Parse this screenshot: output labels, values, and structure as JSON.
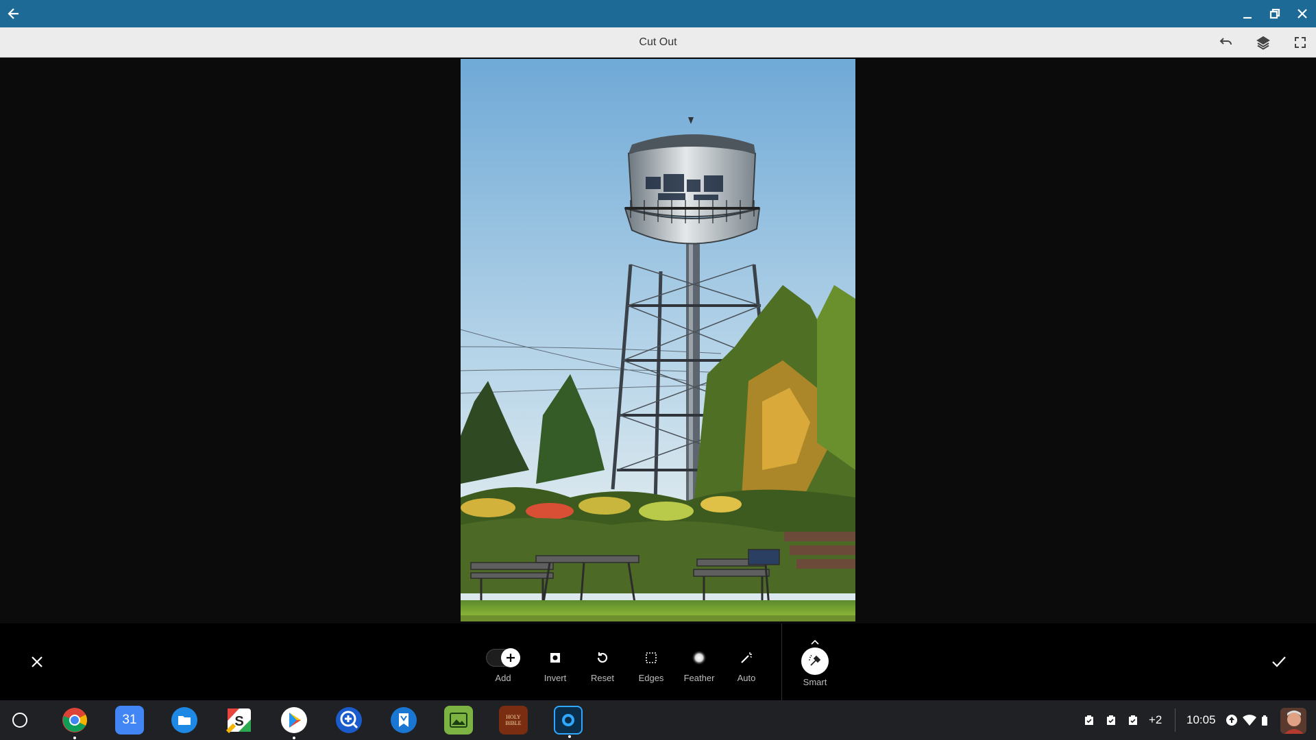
{
  "window": {
    "back_icon": "arrow-left-icon",
    "minimize_icon": "minimize-icon",
    "restore_icon": "restore-icon",
    "close_icon": "close-icon"
  },
  "header": {
    "title": "Cut Out",
    "actions": [
      "undo-icon",
      "layers-icon",
      "fullscreen-icon"
    ]
  },
  "canvas": {
    "image": "water-tower-photo"
  },
  "toolbar": {
    "tools": [
      {
        "label": "Add",
        "icon": "add-toggle-icon"
      },
      {
        "label": "Invert",
        "icon": "invert-icon"
      },
      {
        "label": "Reset",
        "icon": "reset-icon"
      },
      {
        "label": "Edges",
        "icon": "edges-icon"
      },
      {
        "label": "Feather",
        "icon": "feather-icon"
      },
      {
        "label": "Auto",
        "icon": "magic-wand-icon"
      },
      {
        "label": "Smart",
        "icon": "smart-brush-icon"
      }
    ],
    "cancel_icon": "close-icon",
    "confirm_icon": "check-icon"
  },
  "shelf": {
    "apps": [
      "Chrome",
      "Calendar",
      "Files",
      "Slides",
      "Play Store",
      "Zoom",
      "Bookmark",
      "Photo Editor",
      "Holy Bible",
      "Lightroom"
    ],
    "calendar_day": "31",
    "bible_label": "HOLY BIBLE",
    "notifications_extra": "+2",
    "time": "10:05",
    "colors": {
      "titlebar": "#1d6a96",
      "shelf": "#202124"
    }
  }
}
